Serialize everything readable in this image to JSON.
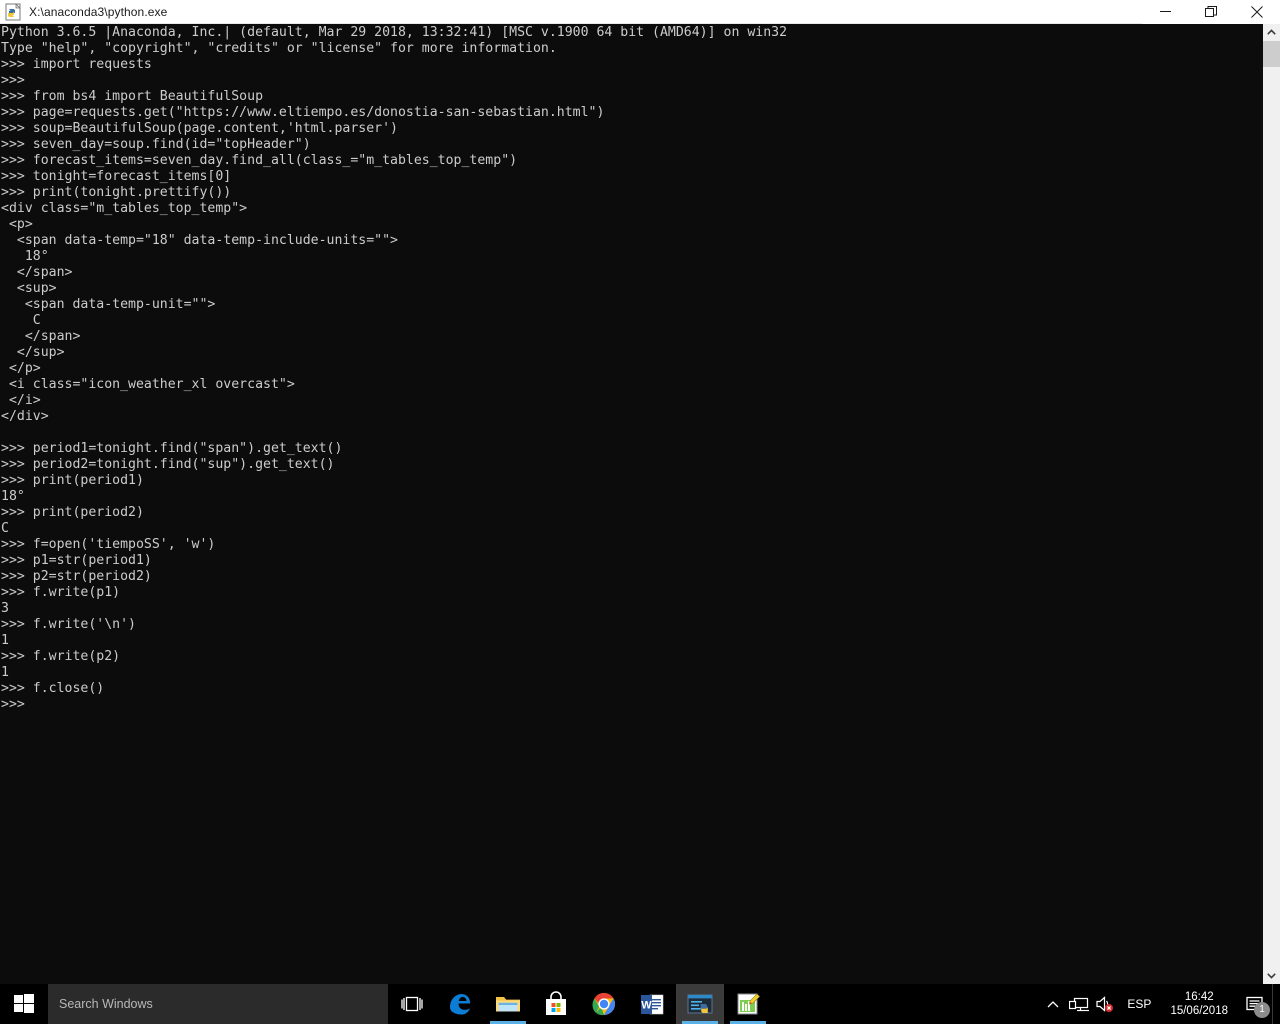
{
  "window": {
    "title": "X:\\anaconda3\\python.exe",
    "icon": "python-file-icon",
    "controls": {
      "minimize_label": "Minimize",
      "restore_label": "Restore",
      "close_label": "Close"
    }
  },
  "console": {
    "background_color": "#0c0c0c",
    "text_color": "#cccccc",
    "text": "Python 3.6.5 |Anaconda, Inc.| (default, Mar 29 2018, 13:32:41) [MSC v.1900 64 bit (AMD64)] on win32\nType \"help\", \"copyright\", \"credits\" or \"license\" for more information.\n>>> import requests\n>>>\n>>> from bs4 import BeautifulSoup\n>>> page=requests.get(\"https://www.eltiempo.es/donostia-san-sebastian.html\")\n>>> soup=BeautifulSoup(page.content,'html.parser')\n>>> seven_day=soup.find(id=\"topHeader\")\n>>> forecast_items=seven_day.find_all(class_=\"m_tables_top_temp\")\n>>> tonight=forecast_items[0]\n>>> print(tonight.prettify())\n<div class=\"m_tables_top_temp\">\n <p>\n  <span data-temp=\"18\" data-temp-include-units=\"\">\n   18°\n  </span>\n  <sup>\n   <span data-temp-unit=\"\">\n    C\n   </span>\n  </sup>\n </p>\n <i class=\"icon_weather_xl overcast\">\n </i>\n</div>\n\n>>> period1=tonight.find(\"span\").get_text()\n>>> period2=tonight.find(\"sup\").get_text()\n>>> print(period1)\n18°\n>>> print(period2)\nC\n>>> f=open('tiempoSS', 'w')\n>>> p1=str(period1)\n>>> p2=str(period2)\n>>> f.write(p1)\n3\n>>> f.write('\\n')\n1\n>>> f.write(p2)\n1\n>>> f.close()\n>>>"
  },
  "scrollbar": {
    "up_arrow": "chevron-up-icon",
    "down_arrow": "chevron-down-icon"
  },
  "taskbar": {
    "start_label": "Start",
    "search": {
      "placeholder": "Search Windows",
      "value": ""
    },
    "task_view_label": "Task View",
    "apps": [
      {
        "name": "microsoft-edge",
        "label": "Microsoft Edge",
        "running": false,
        "active": false
      },
      {
        "name": "file-explorer",
        "label": "File Explorer",
        "running": true,
        "active": false
      },
      {
        "name": "microsoft-store",
        "label": "Microsoft Store",
        "running": false,
        "active": false
      },
      {
        "name": "google-chrome",
        "label": "Google Chrome",
        "running": true,
        "active": false
      },
      {
        "name": "microsoft-word",
        "label": "Microsoft Word",
        "running": true,
        "active": false
      },
      {
        "name": "python-console",
        "label": "python.exe",
        "running": true,
        "active": true
      },
      {
        "name": "notepad-plus-plus",
        "label": "Notepad++",
        "running": true,
        "active": false
      }
    ],
    "tray": {
      "show_hidden_icons": "chevron-up-icon",
      "network": "network-icon",
      "volume": "volume-muted-icon",
      "language": "ESP",
      "time": "16:42",
      "date": "15/06/2018",
      "notification_icon": "action-center-icon",
      "notification_count": "1"
    }
  }
}
